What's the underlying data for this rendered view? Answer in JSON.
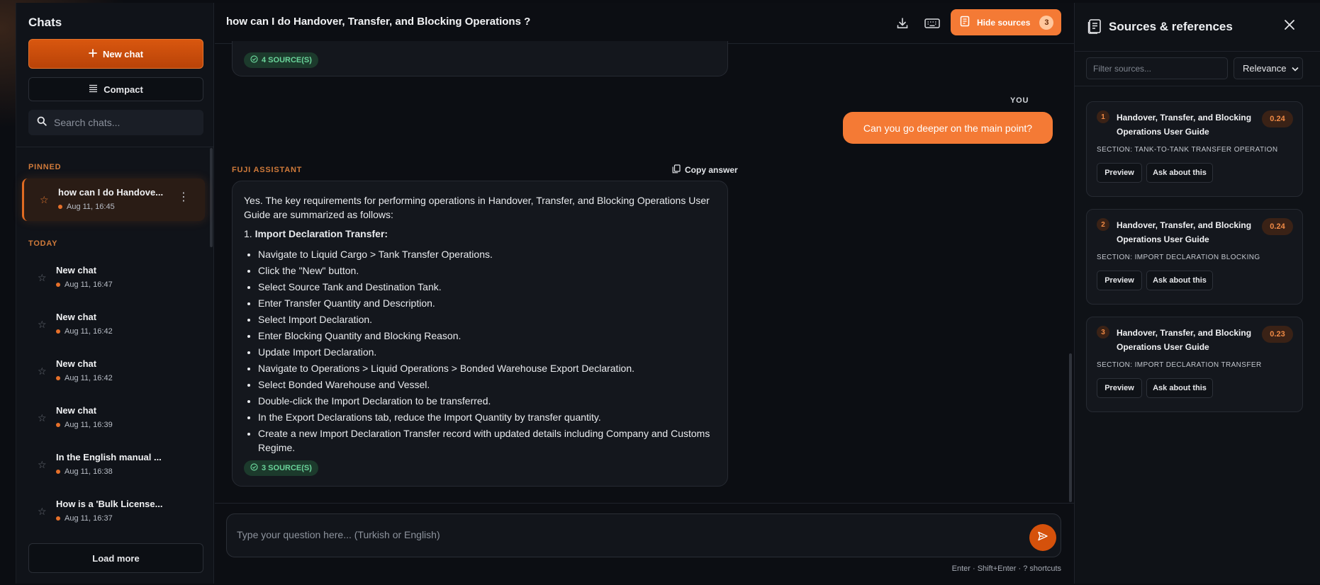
{
  "sidebar": {
    "title": "Chats",
    "new_chat": "New chat",
    "compact": "Compact",
    "search_placeholder": "Search chats...",
    "pinned_label": "PINNED",
    "today_label": "TODAY",
    "pinned": [
      {
        "title": "how can I do Handove...",
        "date": "Aug 11, 16:45"
      }
    ],
    "today": [
      {
        "title": "New chat",
        "date": "Aug 11, 16:47"
      },
      {
        "title": "New chat",
        "date": "Aug 11, 16:42"
      },
      {
        "title": "New chat",
        "date": "Aug 11, 16:42"
      },
      {
        "title": "New chat",
        "date": "Aug 11, 16:39"
      },
      {
        "title": "In the English manual ...",
        "date": "Aug 11, 16:38"
      },
      {
        "title": "How is a 'Bulk License...",
        "date": "Aug 11, 16:37"
      }
    ],
    "load_more": "Load more"
  },
  "header": {
    "title": "how can I do Handover, Transfer, and Blocking Operations ?",
    "hide_sources": "Hide sources",
    "sources_count": "3"
  },
  "conversation": {
    "prev_sources": "4 SOURCE(S)",
    "you_label": "YOU",
    "user_message": "Can you go deeper on the main point?",
    "assistant_label": "FUJI ASSISTANT",
    "copy_answer": "Copy answer",
    "answer_intro": "Yes. The key requirements for performing operations in Handover, Transfer, and Blocking Operations User Guide are summarized as follows:",
    "answer_heading_num": "1.",
    "answer_heading": "Import Declaration Transfer:",
    "answer_items": [
      "Navigate to Liquid Cargo > Tank Transfer Operations.",
      "Click the \"New\" button.",
      "Select Source Tank and Destination Tank.",
      "Enter Transfer Quantity and Description.",
      "Select Import Declaration.",
      "Enter Blocking Quantity and Blocking Reason.",
      "Update Import Declaration.",
      "Navigate to Operations > Liquid Operations > Bonded Warehouse Export Declaration.",
      "Select Bonded Warehouse and Vessel.",
      "Double-click the Import Declaration to be transferred.",
      "In the Export Declarations tab, reduce the Import Quantity by transfer quantity.",
      "Create a new Import Declaration Transfer record with updated details including Company and Customs Regime."
    ],
    "answer_sources": "3 SOURCE(S)"
  },
  "composer": {
    "placeholder": "Type your question here... (Turkish or English)",
    "hint": "Enter · Shift+Enter · ? shortcuts"
  },
  "sources_panel": {
    "title": "Sources & references",
    "filter_placeholder": "Filter sources...",
    "sort_value": "Relevance",
    "preview_label": "Preview",
    "ask_label": "Ask about this",
    "items": [
      {
        "num": "1",
        "title": "Handover, Transfer, and Blocking Operations User Guide",
        "score": "0.24",
        "section": "SECTION: TANK-TO-TANK TRANSFER OPERATION"
      },
      {
        "num": "2",
        "title": "Handover, Transfer, and Blocking Operations User Guide",
        "score": "0.24",
        "section": "SECTION: IMPORT DECLARATION BLOCKING"
      },
      {
        "num": "3",
        "title": "Handover, Transfer, and Blocking Operations User Guide",
        "score": "0.23",
        "section": "SECTION: IMPORT DECLARATION TRANSFER"
      }
    ]
  },
  "colors": {
    "accent": "#f47a35",
    "accent_dark": "#d5510b",
    "source_green": "#6ad49a"
  }
}
